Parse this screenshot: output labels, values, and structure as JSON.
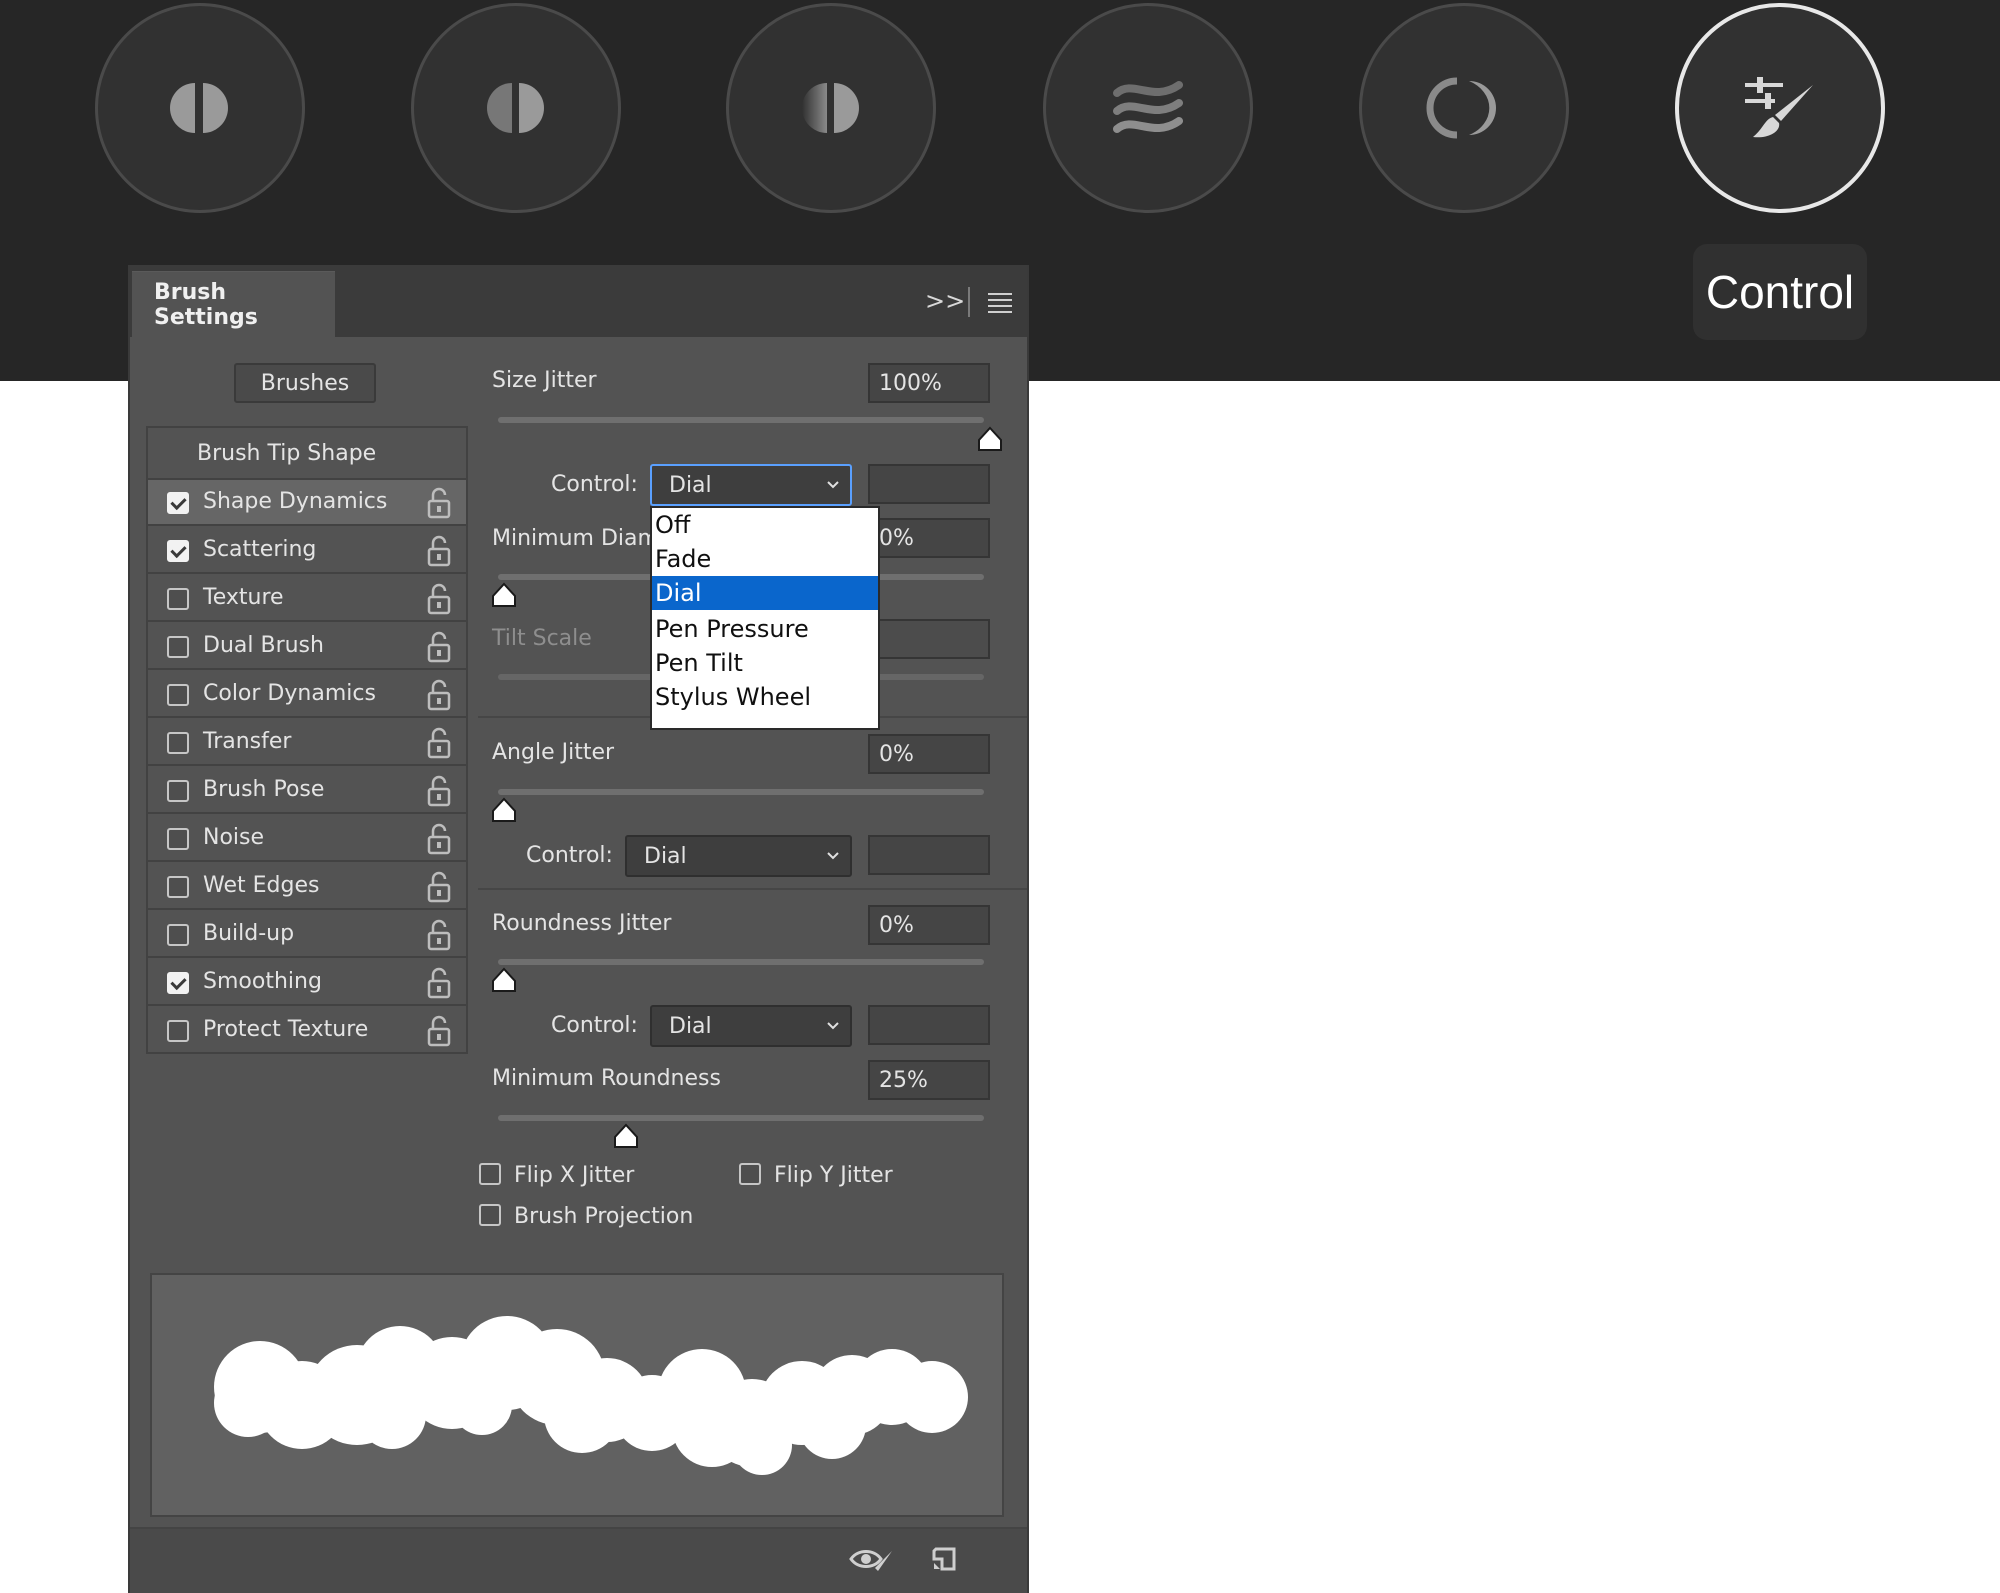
{
  "tooltip": "Control",
  "modes": [
    {
      "icon": "half-circle-icon"
    },
    {
      "icon": "half-circle-outline-icon"
    },
    {
      "icon": "gradient-circle-icon"
    },
    {
      "icon": "waves-icon"
    },
    {
      "icon": "crescent-icon"
    },
    {
      "icon": "brush-sliders-icon"
    }
  ],
  "panel": {
    "title": "Brush Settings",
    "collapse_label": ">>",
    "brushes_button": "Brushes",
    "brush_tip_shape": "Brush Tip Shape",
    "items": [
      {
        "label": "Shape Dynamics",
        "checked": true,
        "selected": true
      },
      {
        "label": "Scattering",
        "checked": true
      },
      {
        "label": "Texture",
        "checked": false
      },
      {
        "label": "Dual Brush",
        "checked": false
      },
      {
        "label": "Color Dynamics",
        "checked": false
      },
      {
        "label": "Transfer",
        "checked": false
      },
      {
        "label": "Brush Pose",
        "checked": false
      },
      {
        "label": "Noise",
        "checked": false
      },
      {
        "label": "Wet Edges",
        "checked": false
      },
      {
        "label": "Build-up",
        "checked": false
      },
      {
        "label": "Smoothing",
        "checked": true
      },
      {
        "label": "Protect Texture",
        "checked": false
      }
    ]
  },
  "settings": {
    "size_jitter": {
      "label": "Size Jitter",
      "value": "100%",
      "slider": 1.0
    },
    "control_label": "Control:",
    "size_control": "Dial",
    "min_diameter": {
      "label": "Minimum Diam",
      "value": "0%",
      "slider": 0.0
    },
    "tilt_scale": {
      "label": "Tilt Scale",
      "value": ""
    },
    "angle_jitter": {
      "label": "Angle Jitter",
      "value": "0%",
      "slider": 0.0
    },
    "angle_control": "Dial",
    "roundness_jitter": {
      "label": "Roundness Jitter",
      "value": "0%",
      "slider": 0.0
    },
    "roundness_control": "Dial",
    "min_roundness": {
      "label": "Minimum Roundness",
      "value": "25%",
      "slider": 0.25
    },
    "flip_x": "Flip X Jitter",
    "flip_y": "Flip Y Jitter",
    "brush_projection": "Brush Projection"
  },
  "dropdown": {
    "options": [
      "Off",
      "Fade",
      "Dial",
      "Pen Pressure",
      "Pen Tilt",
      "Stylus Wheel"
    ],
    "selected": "Dial"
  },
  "colors": {
    "highlight": "#0a66cc",
    "panel": "#535353",
    "strip": "#262626"
  }
}
